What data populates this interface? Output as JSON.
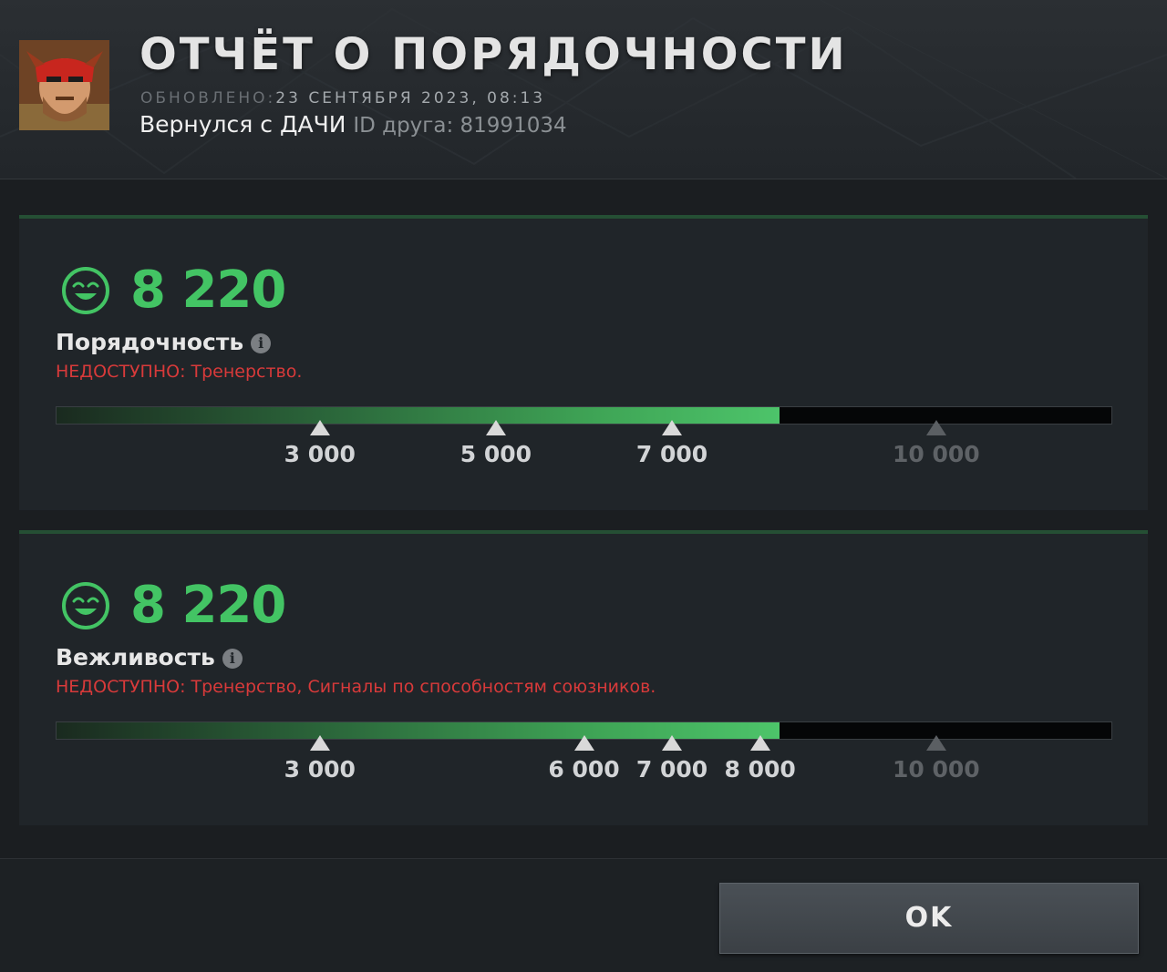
{
  "header": {
    "title": "ОТЧЁТ О ПОРЯДОЧНОСТИ",
    "updated_label": "ОБНОВЛЕНО:",
    "updated_value": "23 СЕНТЯБРЯ 2023, 08:13",
    "player_name": "Вернулся с ДАЧИ",
    "friend_id_label": "ID друга: 81991034"
  },
  "panels": [
    {
      "score": "8 220",
      "label": "Порядочность",
      "unavailable": "НЕДОСТУПНО: Тренерство.",
      "fill_fraction": 0.685,
      "markers": [
        {
          "label": "3 000",
          "value": 3000,
          "reached": true
        },
        {
          "label": "5 000",
          "value": 5000,
          "reached": true
        },
        {
          "label": "7 000",
          "value": 7000,
          "reached": true
        },
        {
          "label": "10 000",
          "value": 10000,
          "reached": false
        }
      ]
    },
    {
      "score": "8 220",
      "label": "Вежливость",
      "unavailable": "НЕДОСТУПНО: Тренерство, Сигналы по способностям союзников.",
      "fill_fraction": 0.685,
      "markers": [
        {
          "label": "3 000",
          "value": 3000,
          "reached": true
        },
        {
          "label": "6 000",
          "value": 6000,
          "reached": true
        },
        {
          "label": "7 000",
          "value": 7000,
          "reached": true
        },
        {
          "label": "8 000",
          "value": 8000,
          "reached": true
        },
        {
          "label": "10 000",
          "value": 10000,
          "reached": false
        }
      ]
    }
  ],
  "ok_button": "OK",
  "icons": {
    "face": "smiling-face-icon",
    "info": "info-icon"
  },
  "colors": {
    "score": "#43c464",
    "warning": "#d83a3a"
  }
}
